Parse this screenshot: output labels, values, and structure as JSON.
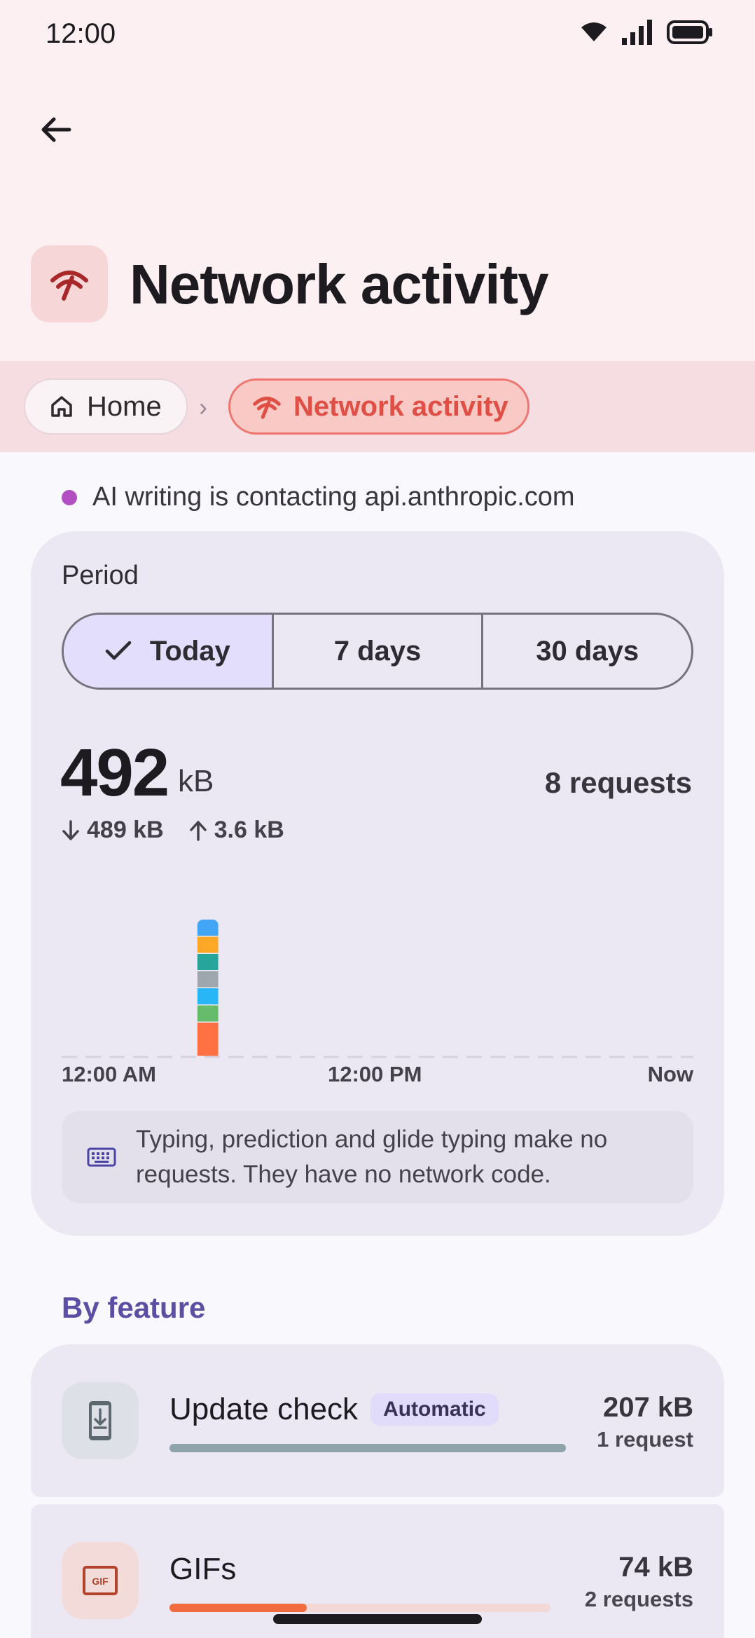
{
  "status_bar": {
    "time": "12:00"
  },
  "header": {
    "title": "Network activity"
  },
  "breadcrumb": {
    "home": "Home",
    "current": "Network activity"
  },
  "activity": {
    "text": "AI writing is contacting api.anthropic.com"
  },
  "period": {
    "label": "Period",
    "options": [
      "Today",
      "7 days",
      "30 days"
    ],
    "selected": "Today"
  },
  "summary": {
    "total_value": "492",
    "total_unit": "kB",
    "requests": "8 requests",
    "download": "489 kB",
    "upload": "3.6 kB"
  },
  "chart_data": {
    "type": "bar",
    "x_ticks": [
      "12:00 AM",
      "12:00 PM",
      "Now"
    ],
    "bar_slot": 5,
    "slot_count": 24,
    "segment_colors": [
      "#ff7043",
      "#66bb6a",
      "#29b6f6",
      "#9ea7ad",
      "#26a69a",
      "#ffa726",
      "#42a5f5"
    ],
    "segment_fractions": [
      0.25,
      0.125,
      0.125,
      0.125,
      0.125,
      0.125,
      0.125
    ]
  },
  "info": {
    "text": "Typing, prediction and glide typing make no requests. They have no network code."
  },
  "by_feature": {
    "heading": "By feature",
    "items": [
      {
        "name": "Update check",
        "badge": "Automatic",
        "size": "207 kB",
        "requests": "1 request",
        "fraction": 1.0,
        "color": "#8fa3ab",
        "icon": "download-phone-icon"
      },
      {
        "name": "GIFs",
        "badge": "",
        "size": "74 kB",
        "requests": "2 requests",
        "fraction": 0.36,
        "color": "#f26b3f",
        "icon": "gif-icon"
      }
    ]
  },
  "colors": {
    "accent": "#e04f45",
    "section": "#5b4ea3",
    "activity_dot": "#b24fc2"
  }
}
